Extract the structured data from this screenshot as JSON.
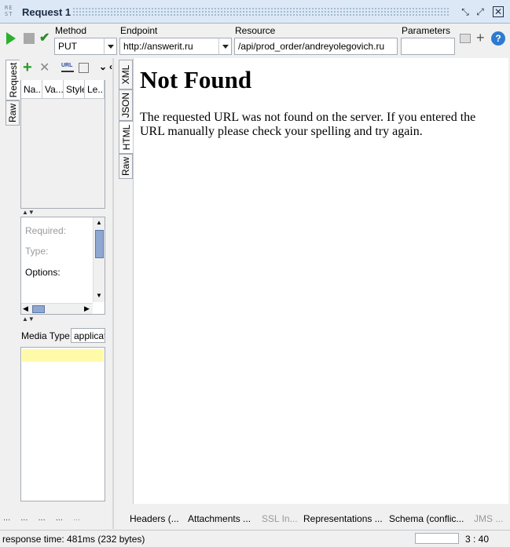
{
  "window": {
    "title": "Request 1",
    "icon_text": "RE ST"
  },
  "toolbar": {
    "method_label": "Method",
    "method_value": "PUT",
    "endpoint_label": "Endpoint",
    "endpoint_value": "http://answerit.ru",
    "resource_label": "Resource",
    "resource_value": "/api/prod_order/andreyolegovich.ru",
    "parameters_label": "Parameters",
    "parameters_value": "",
    "help_text": "?"
  },
  "side_tabs": {
    "request": "Request",
    "raw": "Raw"
  },
  "params": {
    "columns": [
      "Na...",
      "Va...",
      "Style",
      "Le..."
    ],
    "required_label": "Required:",
    "type_label": "Type:",
    "options_label": "Options:",
    "media_type_label": "Media Type",
    "media_type_value": "applicat"
  },
  "response_tabs": [
    "XML",
    "JSON",
    "HTML",
    "Raw"
  ],
  "response": {
    "heading": "Not Found",
    "message": "The requested URL was not found on the server. If you entered the URL manually please check your spelling and try again."
  },
  "bottom_tabs": [
    "Headers (...",
    "Attachments ...",
    "SSL In...",
    "Representations ...",
    "Schema (conflic...",
    "JMS ..."
  ],
  "left_dots": [
    "...",
    "...",
    "...",
    "...",
    "...",
    "..."
  ],
  "status": {
    "response_time": "response time: 481ms (232 bytes)",
    "position": "3 : 40"
  },
  "colors": {
    "accent": "#2c7bd1",
    "play": "#2bb02b",
    "highlight": "#fffaa8"
  }
}
